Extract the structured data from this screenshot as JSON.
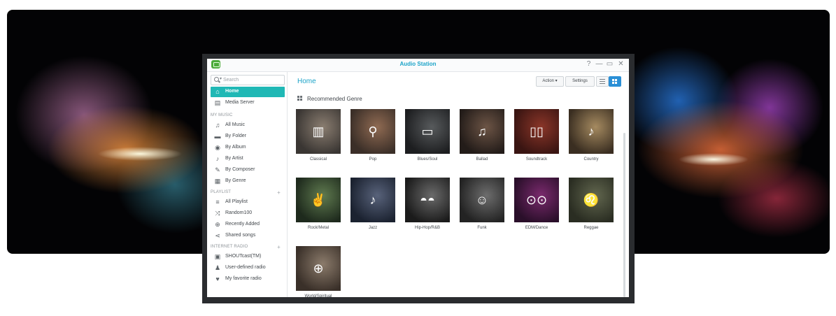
{
  "window": {
    "title": "Audio Station"
  },
  "window_controls": [
    {
      "name": "help-icon",
      "glyph": "?"
    },
    {
      "name": "minimize-icon",
      "glyph": "—"
    },
    {
      "name": "maximize-icon",
      "glyph": "▭"
    },
    {
      "name": "close-icon",
      "glyph": "✕"
    }
  ],
  "search": {
    "placeholder": "Search"
  },
  "sidebar": {
    "top_items": [
      {
        "label": "Home",
        "icon": "home-icon",
        "glyph": "⌂",
        "active": true
      },
      {
        "label": "Media Server",
        "icon": "media-server-icon",
        "glyph": "▤",
        "active": false
      }
    ],
    "sections": [
      {
        "title": "MY MUSIC",
        "has_add": false,
        "items": [
          {
            "label": "All Music",
            "icon": "music-note-icon",
            "glyph": "♫"
          },
          {
            "label": "By Folder",
            "icon": "folder-icon",
            "glyph": "▬"
          },
          {
            "label": "By Album",
            "icon": "album-icon",
            "glyph": "◉"
          },
          {
            "label": "By Artist",
            "icon": "microphone-icon",
            "glyph": "♪"
          },
          {
            "label": "By Composer",
            "icon": "composer-icon",
            "glyph": "✎"
          },
          {
            "label": "By Genre",
            "icon": "genre-icon",
            "glyph": "▦"
          }
        ]
      },
      {
        "title": "PLAYLIST",
        "has_add": true,
        "items": [
          {
            "label": "All Playlist",
            "icon": "playlist-icon",
            "glyph": "≡"
          },
          {
            "label": "Random100",
            "icon": "shuffle-icon",
            "glyph": "⤨"
          },
          {
            "label": "Recently Added",
            "icon": "add-circle-icon",
            "glyph": "⊕"
          },
          {
            "label": "Shared songs",
            "icon": "share-icon",
            "glyph": "⋖"
          }
        ]
      },
      {
        "title": "INTERNET RADIO",
        "has_add": true,
        "items": [
          {
            "label": "SHOUTcast(TM)",
            "icon": "radio-icon",
            "glyph": "▣"
          },
          {
            "label": "User-defined radio",
            "icon": "user-radio-icon",
            "glyph": "♟"
          },
          {
            "label": "My favorite radio",
            "icon": "heart-icon",
            "glyph": "♥"
          }
        ]
      }
    ]
  },
  "main": {
    "title": "Home",
    "action_label": "Action ▾",
    "settings_label": "Settings",
    "section_title": "Recommended Genre",
    "genres": [
      {
        "label": "Classical",
        "icon": "piano-icon",
        "glyph": "▥",
        "colors": [
          "#3a3633",
          "#8a7d70"
        ]
      },
      {
        "label": "Pop",
        "icon": "microphone-icon",
        "glyph": "⚲",
        "colors": [
          "#3b2f28",
          "#8f6a52"
        ]
      },
      {
        "label": "Blues/Soul",
        "icon": "harmonica-icon",
        "glyph": "▭",
        "colors": [
          "#1d1e20",
          "#575a5c"
        ]
      },
      {
        "label": "Ballad",
        "icon": "music-notes-icon",
        "glyph": "♫",
        "colors": [
          "#231c19",
          "#6c5445"
        ]
      },
      {
        "label": "Soundtrack",
        "icon": "speakers-icon",
        "glyph": "▯▯",
        "colors": [
          "#3a1512",
          "#8a3528"
        ]
      },
      {
        "label": "Country",
        "icon": "guitar-icon",
        "glyph": "♪",
        "colors": [
          "#3a2e21",
          "#a58a60"
        ]
      },
      {
        "label": "Rock/Metal",
        "icon": "rock-hand-guitar-icon",
        "glyph": "✌",
        "colors": [
          "#1e2a1d",
          "#5f7a4f"
        ]
      },
      {
        "label": "Jazz",
        "icon": "saxophone-icon",
        "glyph": "♪",
        "colors": [
          "#1b2230",
          "#58627a"
        ]
      },
      {
        "label": "Hip-Hop/R&B",
        "icon": "sunglasses-icon",
        "glyph": "◓◓",
        "colors": [
          "#1b1b1b",
          "#6a6a6a"
        ]
      },
      {
        "label": "Funk",
        "icon": "afro-guitar-icon",
        "glyph": "☺",
        "colors": [
          "#232323",
          "#6d6d6d"
        ]
      },
      {
        "label": "EDM/Dance",
        "icon": "boombox-icon",
        "glyph": "⊙⊙",
        "colors": [
          "#2a0f2a",
          "#7a2a6d"
        ]
      },
      {
        "label": "Reggae",
        "icon": "lion-icon",
        "glyph": "♌",
        "colors": [
          "#2a2d22",
          "#61664e"
        ]
      },
      {
        "label": "World/Spiritual",
        "icon": "globe-icon",
        "glyph": "⊕",
        "colors": [
          "#3a3029",
          "#8b7b6b"
        ]
      }
    ]
  }
}
